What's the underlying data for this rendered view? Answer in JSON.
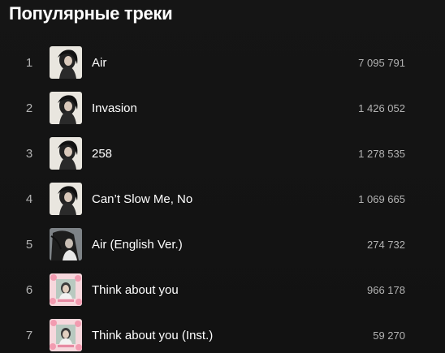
{
  "section": {
    "title": "Популярные треки"
  },
  "tracks": [
    {
      "index": "1",
      "title": "Air",
      "plays": "7 095 791",
      "cover": "album-cover-air-icon"
    },
    {
      "index": "2",
      "title": "Invasion",
      "plays": "1 426 052",
      "cover": "album-cover-air-icon"
    },
    {
      "index": "3",
      "title": "258",
      "plays": "1 278 535",
      "cover": "album-cover-air-icon"
    },
    {
      "index": "4",
      "title": "Can’t Slow Me, No",
      "plays": "1 069 665",
      "cover": "album-cover-air-icon"
    },
    {
      "index": "5",
      "title": "Air (English Ver.)",
      "plays": "274 732",
      "cover": "album-cover-air-english-icon"
    },
    {
      "index": "6",
      "title": "Think about you",
      "plays": "966 178",
      "cover": "album-cover-think-about-you-icon"
    },
    {
      "index": "7",
      "title": "Think about you (Inst.)",
      "plays": "59 270",
      "cover": "album-cover-think-about-you-icon"
    }
  ],
  "colors": {
    "background": "#121212",
    "primary_text": "#ffffff",
    "secondary_text": "#b3b3b3"
  }
}
